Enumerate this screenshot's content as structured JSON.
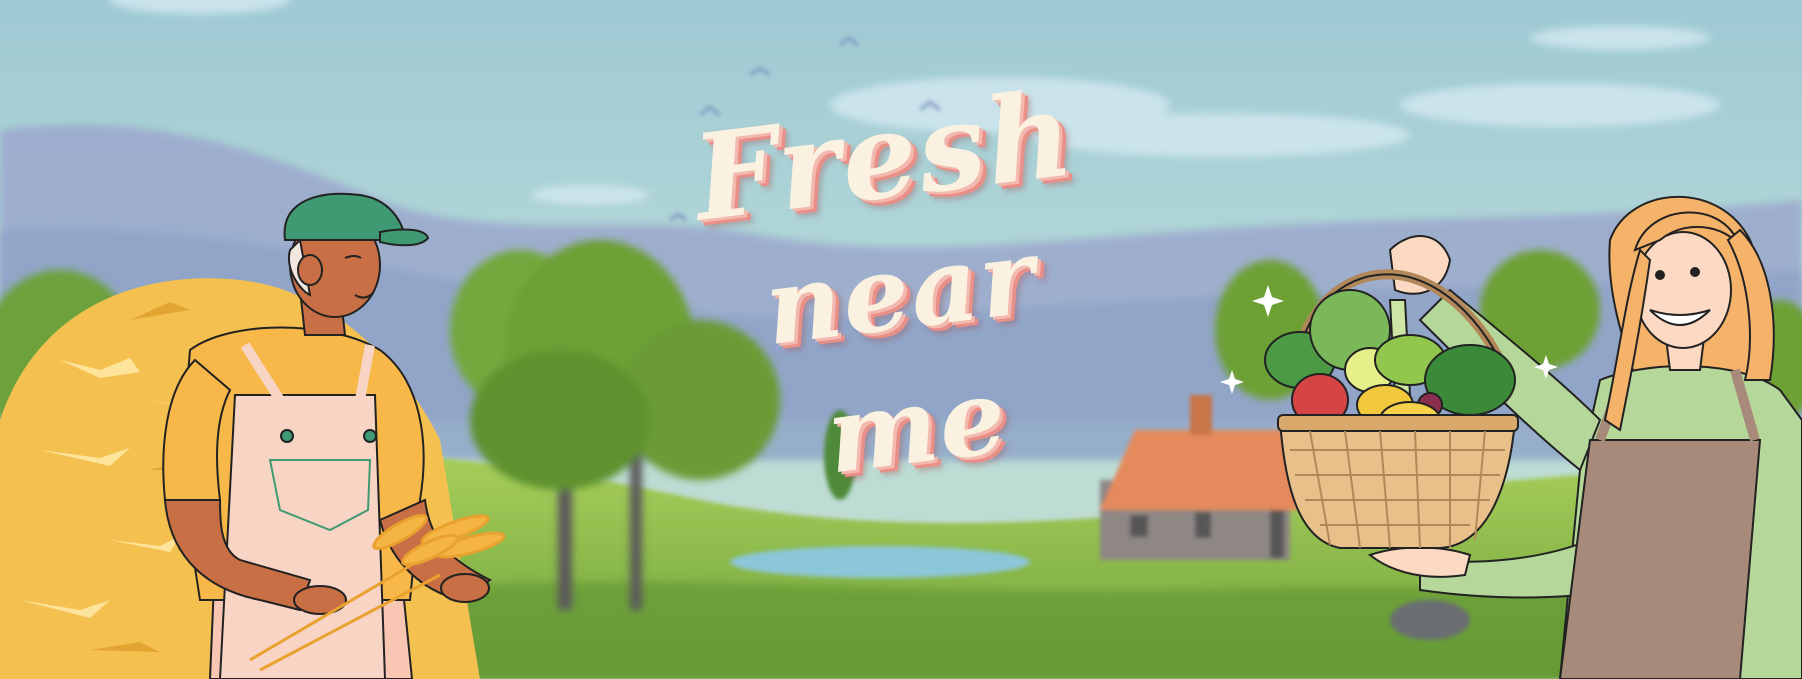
{
  "banner": {
    "title_lines": [
      "Fresh",
      "near",
      "me"
    ]
  },
  "colors": {
    "sky": "#a9cfd6",
    "title_fill": "#fbf1e1",
    "title_shadow": "#ea8f88",
    "grass": "#8fbf4a",
    "hay": "#f4c04f",
    "cap": "#3f9a73",
    "apron": "#a88a7a"
  },
  "icons": [
    "birds-icon",
    "sparkle-icon",
    "basket-icon",
    "house-icon"
  ]
}
